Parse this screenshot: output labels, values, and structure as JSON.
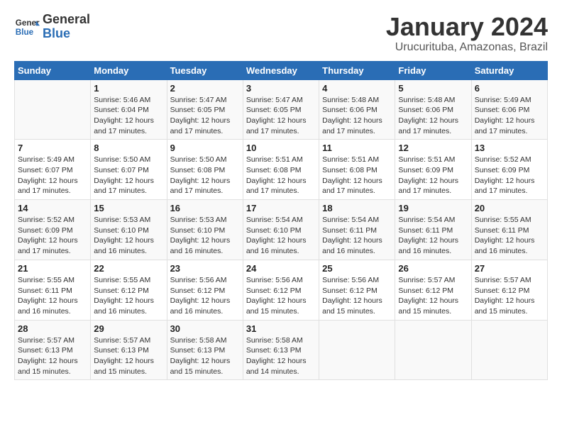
{
  "logo": {
    "line1": "General",
    "line2": "Blue"
  },
  "title": "January 2024",
  "subtitle": "Urucurituba, Amazonas, Brazil",
  "days_of_week": [
    "Sunday",
    "Monday",
    "Tuesday",
    "Wednesday",
    "Thursday",
    "Friday",
    "Saturday"
  ],
  "weeks": [
    [
      {
        "num": "",
        "info": ""
      },
      {
        "num": "1",
        "info": "Sunrise: 5:46 AM\nSunset: 6:04 PM\nDaylight: 12 hours\nand 17 minutes."
      },
      {
        "num": "2",
        "info": "Sunrise: 5:47 AM\nSunset: 6:05 PM\nDaylight: 12 hours\nand 17 minutes."
      },
      {
        "num": "3",
        "info": "Sunrise: 5:47 AM\nSunset: 6:05 PM\nDaylight: 12 hours\nand 17 minutes."
      },
      {
        "num": "4",
        "info": "Sunrise: 5:48 AM\nSunset: 6:06 PM\nDaylight: 12 hours\nand 17 minutes."
      },
      {
        "num": "5",
        "info": "Sunrise: 5:48 AM\nSunset: 6:06 PM\nDaylight: 12 hours\nand 17 minutes."
      },
      {
        "num": "6",
        "info": "Sunrise: 5:49 AM\nSunset: 6:06 PM\nDaylight: 12 hours\nand 17 minutes."
      }
    ],
    [
      {
        "num": "7",
        "info": "Sunrise: 5:49 AM\nSunset: 6:07 PM\nDaylight: 12 hours\nand 17 minutes."
      },
      {
        "num": "8",
        "info": "Sunrise: 5:50 AM\nSunset: 6:07 PM\nDaylight: 12 hours\nand 17 minutes."
      },
      {
        "num": "9",
        "info": "Sunrise: 5:50 AM\nSunset: 6:08 PM\nDaylight: 12 hours\nand 17 minutes."
      },
      {
        "num": "10",
        "info": "Sunrise: 5:51 AM\nSunset: 6:08 PM\nDaylight: 12 hours\nand 17 minutes."
      },
      {
        "num": "11",
        "info": "Sunrise: 5:51 AM\nSunset: 6:08 PM\nDaylight: 12 hours\nand 17 minutes."
      },
      {
        "num": "12",
        "info": "Sunrise: 5:51 AM\nSunset: 6:09 PM\nDaylight: 12 hours\nand 17 minutes."
      },
      {
        "num": "13",
        "info": "Sunrise: 5:52 AM\nSunset: 6:09 PM\nDaylight: 12 hours\nand 17 minutes."
      }
    ],
    [
      {
        "num": "14",
        "info": "Sunrise: 5:52 AM\nSunset: 6:09 PM\nDaylight: 12 hours\nand 17 minutes."
      },
      {
        "num": "15",
        "info": "Sunrise: 5:53 AM\nSunset: 6:10 PM\nDaylight: 12 hours\nand 16 minutes."
      },
      {
        "num": "16",
        "info": "Sunrise: 5:53 AM\nSunset: 6:10 PM\nDaylight: 12 hours\nand 16 minutes."
      },
      {
        "num": "17",
        "info": "Sunrise: 5:54 AM\nSunset: 6:10 PM\nDaylight: 12 hours\nand 16 minutes."
      },
      {
        "num": "18",
        "info": "Sunrise: 5:54 AM\nSunset: 6:11 PM\nDaylight: 12 hours\nand 16 minutes."
      },
      {
        "num": "19",
        "info": "Sunrise: 5:54 AM\nSunset: 6:11 PM\nDaylight: 12 hours\nand 16 minutes."
      },
      {
        "num": "20",
        "info": "Sunrise: 5:55 AM\nSunset: 6:11 PM\nDaylight: 12 hours\nand 16 minutes."
      }
    ],
    [
      {
        "num": "21",
        "info": "Sunrise: 5:55 AM\nSunset: 6:11 PM\nDaylight: 12 hours\nand 16 minutes."
      },
      {
        "num": "22",
        "info": "Sunrise: 5:55 AM\nSunset: 6:12 PM\nDaylight: 12 hours\nand 16 minutes."
      },
      {
        "num": "23",
        "info": "Sunrise: 5:56 AM\nSunset: 6:12 PM\nDaylight: 12 hours\nand 16 minutes."
      },
      {
        "num": "24",
        "info": "Sunrise: 5:56 AM\nSunset: 6:12 PM\nDaylight: 12 hours\nand 15 minutes."
      },
      {
        "num": "25",
        "info": "Sunrise: 5:56 AM\nSunset: 6:12 PM\nDaylight: 12 hours\nand 15 minutes."
      },
      {
        "num": "26",
        "info": "Sunrise: 5:57 AM\nSunset: 6:12 PM\nDaylight: 12 hours\nand 15 minutes."
      },
      {
        "num": "27",
        "info": "Sunrise: 5:57 AM\nSunset: 6:12 PM\nDaylight: 12 hours\nand 15 minutes."
      }
    ],
    [
      {
        "num": "28",
        "info": "Sunrise: 5:57 AM\nSunset: 6:13 PM\nDaylight: 12 hours\nand 15 minutes."
      },
      {
        "num": "29",
        "info": "Sunrise: 5:57 AM\nSunset: 6:13 PM\nDaylight: 12 hours\nand 15 minutes."
      },
      {
        "num": "30",
        "info": "Sunrise: 5:58 AM\nSunset: 6:13 PM\nDaylight: 12 hours\nand 15 minutes."
      },
      {
        "num": "31",
        "info": "Sunrise: 5:58 AM\nSunset: 6:13 PM\nDaylight: 12 hours\nand 14 minutes."
      },
      {
        "num": "",
        "info": ""
      },
      {
        "num": "",
        "info": ""
      },
      {
        "num": "",
        "info": ""
      }
    ]
  ]
}
